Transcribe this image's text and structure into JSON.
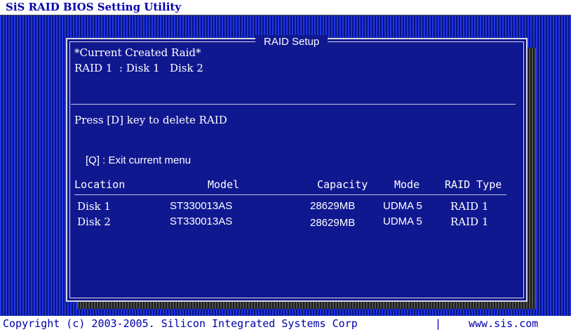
{
  "app": {
    "title": "SiS RAID BIOS Setting Utility"
  },
  "dialog": {
    "title": "RAID Setup",
    "current_header": "*Current Created Raid*",
    "current_raid": "RAID 1  : Disk 1   Disk 2",
    "delete_hint": "Press [D] key to delete RAID",
    "exit_hint": "[Q] : Exit current menu"
  },
  "table": {
    "headers": [
      "Location",
      "Model",
      "Capacity",
      "Mode",
      "RAID Type"
    ],
    "rows": [
      [
        "Disk 1",
        "ST330013AS",
        "28629MB",
        "UDMA 5",
        "RAID 1"
      ],
      [
        "Disk 2",
        "ST330013AS",
        "28629MB",
        "UDMA 5",
        "RAID 1"
      ]
    ]
  },
  "footer": {
    "copyright": "Copyright (c) 2003-2005. Silicon Integrated Systems Corp",
    "separator": "|",
    "website": "www.sis.com"
  },
  "colors": {
    "background_blue": "#0b1a9a",
    "dialog_blue": "#101890",
    "bar_text_blue": "#0000aa",
    "text_white": "#ffffff"
  }
}
